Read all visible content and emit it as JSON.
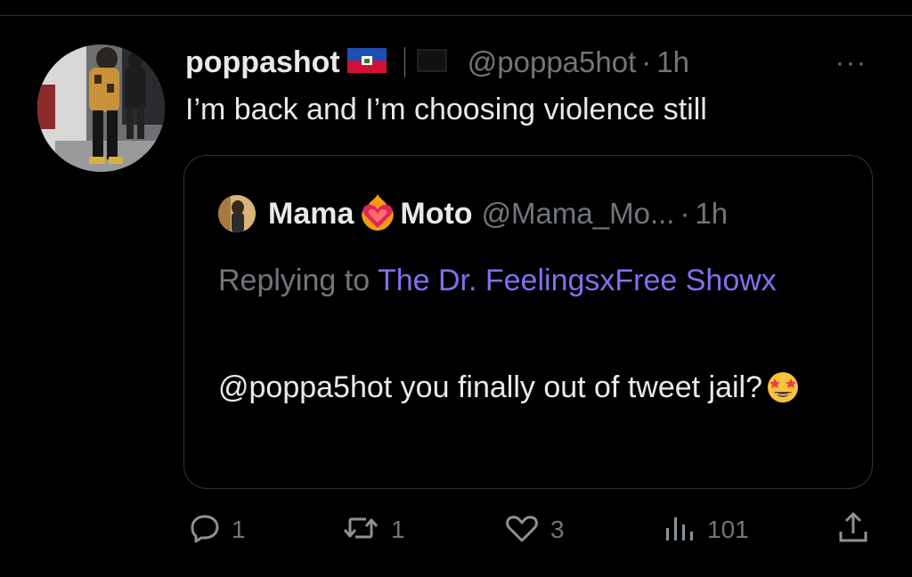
{
  "tweet": {
    "display_name": "poppashot",
    "handle": "@poppa5hot",
    "time": "1h",
    "text": "I’m back and I’m choosing violence still",
    "more_label": "···"
  },
  "quoted_tweet": {
    "name_first": "Mama",
    "name_second": "Moto",
    "handle": "@Mama_Mo...",
    "time": "1h",
    "replying_prefix": "Replying to",
    "replying_to": "The Dr. FeelingsxFree Showx",
    "text": "@poppa5hot you finally out of tweet jail?"
  },
  "actions": {
    "replies": "1",
    "retweets": "1",
    "likes": "3",
    "views": "101"
  },
  "icons": {
    "header": [
      "haiti-flag-icon",
      "black-flag-icon",
      "more-icon"
    ],
    "quote": [
      "heart-on-fire-icon",
      "star-struck-emoji-icon"
    ],
    "actions": [
      "reply-icon",
      "retweet-icon",
      "like-icon",
      "views-icon",
      "share-icon"
    ]
  },
  "colors": {
    "background": "#000000",
    "text": "#e7e9ea",
    "secondary": "#71767b",
    "link": "#8170f0",
    "border": "#2f3336"
  }
}
